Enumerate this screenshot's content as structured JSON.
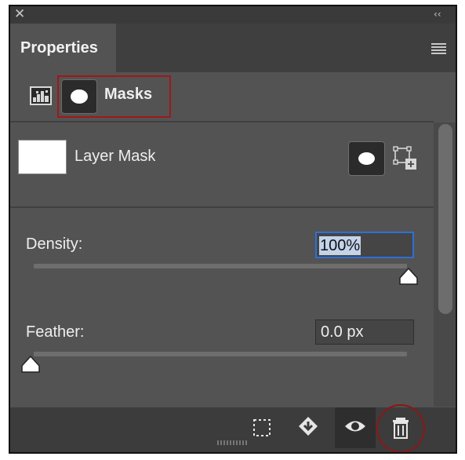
{
  "window": {
    "close_glyph": "✕",
    "collapse_glyph": "‹‹"
  },
  "tabs": [
    {
      "label": "Properties",
      "active": true
    }
  ],
  "panel_menu_icon": "hamburger-menu-icon",
  "mode_switch": {
    "pixel_icon": "pixel-layer-icon",
    "masks_icon": "mask-icon",
    "masks_label": "Masks",
    "highlight_color": "#a01818"
  },
  "layer_mask": {
    "label": "Layer Mask",
    "add_pixel_mask_icon": "pixel-mask-icon",
    "add_vector_mask_icon": "vector-mask-icon"
  },
  "density": {
    "label": "Density:",
    "value": "100%",
    "slider_fraction": 1.0
  },
  "feather": {
    "label": "Feather:",
    "value": "0.0 px",
    "slider_fraction": 0.0
  },
  "bottom_toolbar": [
    {
      "name": "load-selection",
      "icon": "dashed-selection-icon"
    },
    {
      "name": "apply-mask",
      "icon": "apply-mask-icon"
    },
    {
      "name": "toggle-mask",
      "icon": "eye-icon"
    },
    {
      "name": "delete-mask",
      "icon": "trash-icon"
    }
  ],
  "colors": {
    "panel_bg": "#535353",
    "header_bg": "#3f3f3f",
    "focus_blue": "#2f6fd6",
    "annotation_red": "#a01818"
  }
}
